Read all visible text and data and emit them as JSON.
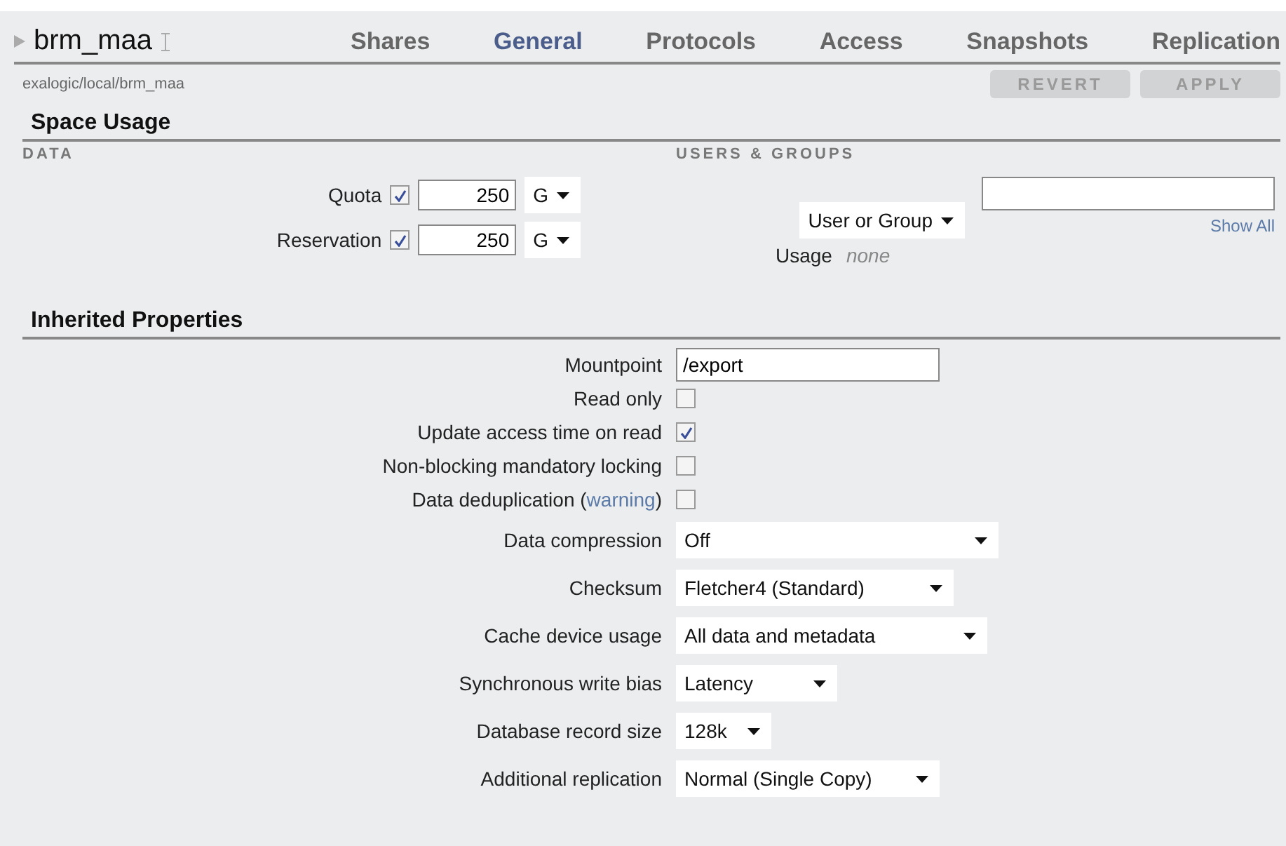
{
  "header": {
    "title": "brm_maa",
    "path": "exalogic/local/brm_maa"
  },
  "tabs": [
    {
      "label": "Shares",
      "selected": false
    },
    {
      "label": "General",
      "selected": true
    },
    {
      "label": "Protocols",
      "selected": false
    },
    {
      "label": "Access",
      "selected": false
    },
    {
      "label": "Snapshots",
      "selected": false
    },
    {
      "label": "Replication",
      "selected": false
    }
  ],
  "buttons": [
    {
      "label": "REVERT",
      "disabled": true
    },
    {
      "label": "APPLY",
      "disabled": true
    }
  ],
  "space_usage": {
    "title": "Space Usage",
    "data_heading": "DATA",
    "users_heading": "USERS & GROUPS",
    "data_rows": [
      {
        "label": "Quota",
        "checked": true,
        "value": "250",
        "unit": "G"
      },
      {
        "label": "Reservation",
        "checked": true,
        "value": "250",
        "unit": "G"
      }
    ],
    "user_select": "User or Group",
    "show_all": "Show All",
    "usage_label": "Usage",
    "usage_value": "none"
  },
  "inherited": {
    "title": "Inherited Properties",
    "rows": [
      {
        "kind": "text",
        "label": "Mountpoint",
        "value": "/export"
      },
      {
        "kind": "checkbox",
        "label": "Read only",
        "checked": false
      },
      {
        "kind": "checkbox",
        "label": "Update access time on read",
        "checked": true
      },
      {
        "kind": "checkbox",
        "label": "Non-blocking mandatory locking",
        "checked": false
      },
      {
        "kind": "checkbox",
        "label": "Data deduplication (",
        "link": "warning",
        "label_end": ")",
        "checked": false
      },
      {
        "kind": "select",
        "label": "Data compression",
        "value": "Off"
      },
      {
        "kind": "select",
        "label": "Checksum",
        "value": "Fletcher4 (Standard)"
      },
      {
        "kind": "select",
        "label": "Cache device usage",
        "value": "All data and metadata"
      },
      {
        "kind": "select",
        "label": "Synchronous write bias",
        "value": "Latency"
      },
      {
        "kind": "select",
        "label": "Database record size",
        "value": "128k"
      },
      {
        "kind": "select",
        "label": "Additional replication",
        "value": "Normal (Single Copy)"
      }
    ]
  }
}
